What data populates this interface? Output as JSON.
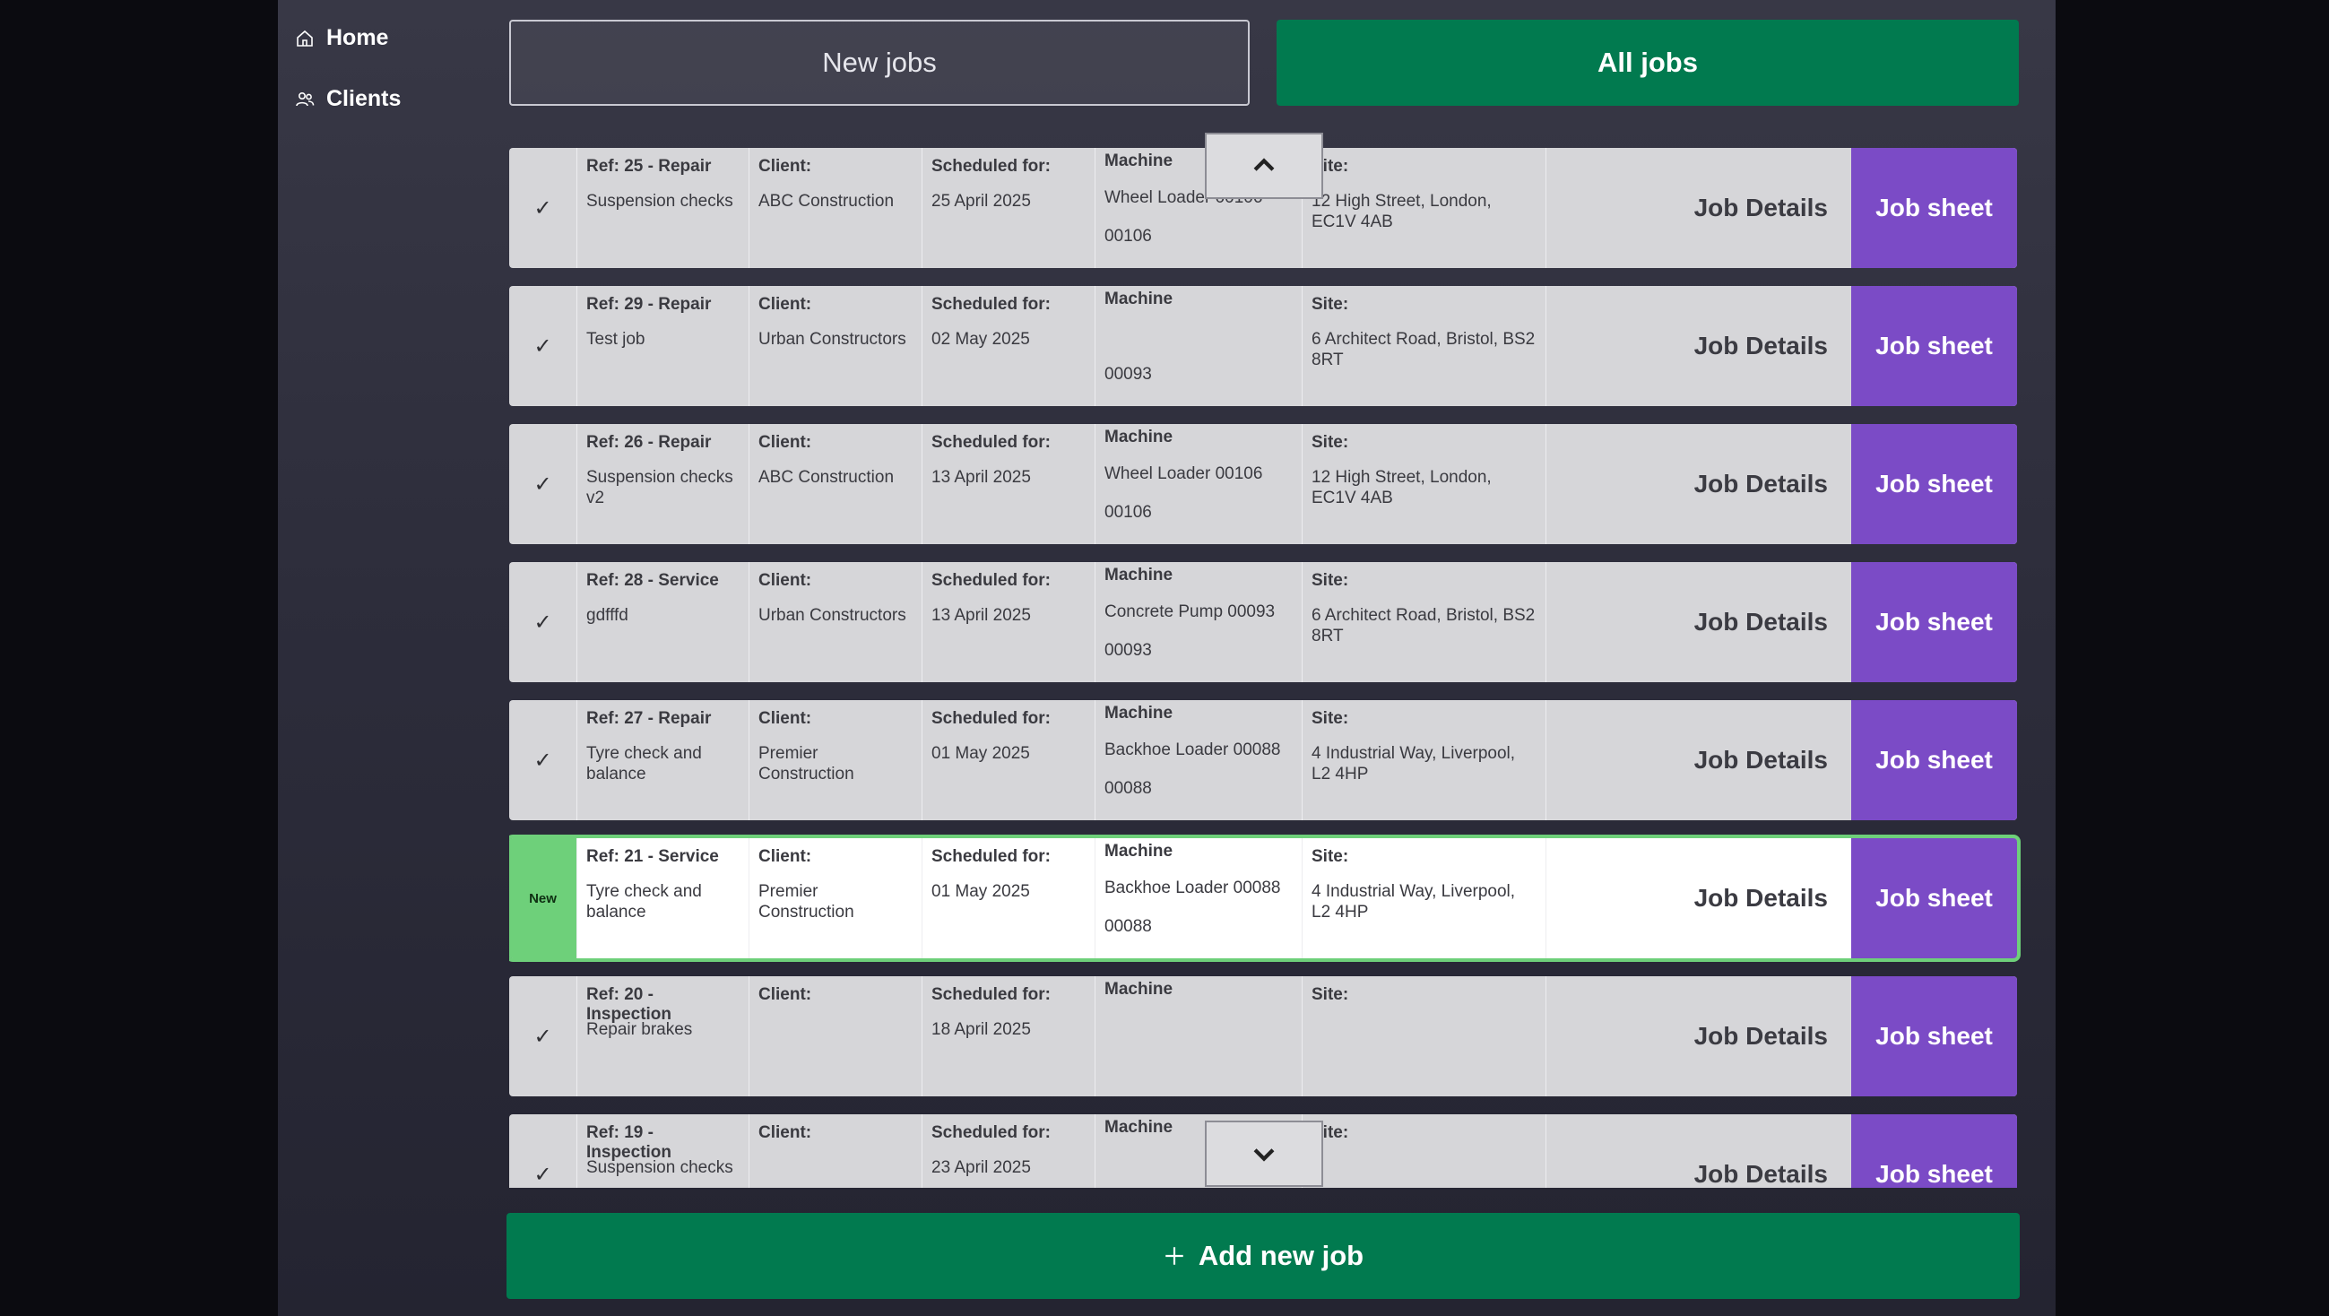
{
  "sidebar": {
    "items": [
      {
        "label": "Home",
        "icon": "home-icon"
      },
      {
        "label": "Clients",
        "icon": "users-icon"
      }
    ]
  },
  "tabs": {
    "new_jobs": "New jobs",
    "all_jobs": "All jobs"
  },
  "labels": {
    "client": "Client:",
    "scheduled": "Scheduled for:",
    "machine": "Machine",
    "site": "Site:",
    "job_details": "Job Details",
    "job_sheet": "Job sheet"
  },
  "jobs": [
    {
      "status": "✓",
      "ref": "Ref: 25 - Repair",
      "description": "Suspension checks",
      "client": "ABC Construction",
      "scheduled": "25 April 2025",
      "machine": "Wheel Loader 00106",
      "machine_code": "00106",
      "site": "12 High Street, London, EC1V 4AB",
      "is_new": false
    },
    {
      "status": "✓",
      "ref": "Ref: 29 - Repair",
      "description": "Test job",
      "client": "Urban Constructors",
      "scheduled": "02 May 2025",
      "machine": "",
      "machine_code": "00093",
      "site": "6 Architect Road, Bristol, BS2 8RT",
      "is_new": false
    },
    {
      "status": "✓",
      "ref": "Ref: 26 - Repair",
      "description": "Suspension checks v2",
      "client": "ABC Construction",
      "scheduled": "13 April 2025",
      "machine": "Wheel Loader 00106",
      "machine_code": "00106",
      "site": "12 High Street, London, EC1V 4AB",
      "is_new": false
    },
    {
      "status": "✓",
      "ref": "Ref: 28 - Service",
      "description": "gdfffd",
      "client": "Urban Constructors",
      "scheduled": "13 April 2025",
      "machine": "Concrete Pump 00093",
      "machine_code": "00093",
      "site": "6 Architect Road, Bristol, BS2 8RT",
      "is_new": false
    },
    {
      "status": "✓",
      "ref": "Ref: 27 - Repair",
      "description": "Tyre check and balance",
      "client": "Premier Construction",
      "scheduled": "01 May 2025",
      "machine": "Backhoe Loader 00088",
      "machine_code": "00088",
      "site": "4 Industrial Way, Liverpool, L2 4HP",
      "is_new": false
    },
    {
      "status": "New",
      "ref": "Ref: 21 - Service",
      "description": "Tyre check and balance",
      "client": "Premier Construction",
      "scheduled": "01 May 2025",
      "machine": "Backhoe Loader 00088",
      "machine_code": "00088",
      "site": "4 Industrial Way, Liverpool, L2 4HP",
      "is_new": true
    },
    {
      "status": "✓",
      "ref": "Ref: 20 - Inspection",
      "description": "Repair brakes",
      "client": "",
      "scheduled": "18 April 2025",
      "machine": "",
      "machine_code": "",
      "site": "",
      "is_new": false
    },
    {
      "status": "✓",
      "ref": "Ref: 19 - Inspection",
      "description": "Suspension checks",
      "client": "",
      "scheduled": "23 April 2025",
      "machine": "",
      "machine_code": "",
      "site": "",
      "is_new": false
    }
  ],
  "scroll": {
    "up_icon": "chevron-up-icon",
    "down_icon": "chevron-down-icon"
  },
  "add_job": {
    "label": "Add new job",
    "icon": "plus-icon"
  }
}
